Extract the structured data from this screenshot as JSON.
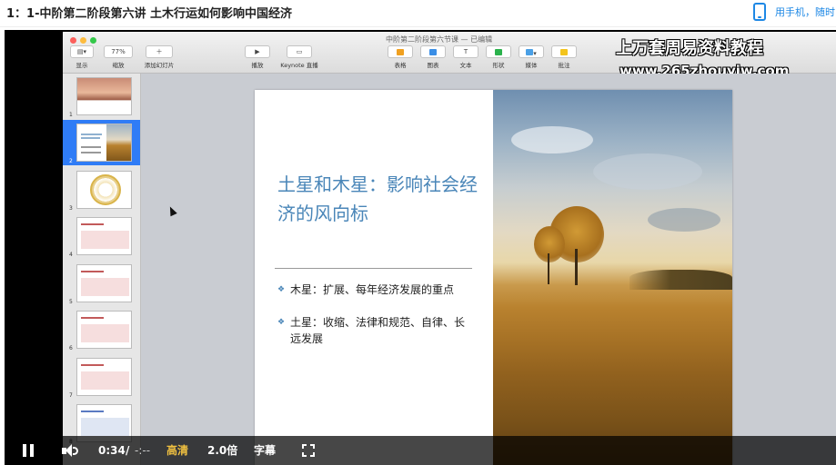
{
  "page": {
    "title": "1：1-中阶第二阶段第六讲 土木行运如何影响中国经济",
    "mobile_link": "用手机，随时"
  },
  "keynote": {
    "doc_title": "中阶第二阶段第六节课 — 已编辑",
    "toolbar": {
      "view": "显示",
      "zoom_value": "77%",
      "zoom": "缩放",
      "add_slide": "添加幻灯片",
      "play": "播放",
      "keynote_live": "Keynote 直播",
      "table": "表格",
      "chart": "图表",
      "text": "文本",
      "shape": "形状",
      "media": "媒体",
      "comment": "批注"
    },
    "watermark": {
      "line1": "上万套周易资料教程",
      "line2": "www.265zhouyiw.com"
    },
    "slides": [
      {
        "num": "1"
      },
      {
        "num": "2"
      },
      {
        "num": "3"
      },
      {
        "num": "4"
      },
      {
        "num": "5"
      },
      {
        "num": "6"
      },
      {
        "num": "7"
      },
      {
        "num": "8"
      }
    ],
    "selected_slide": 2,
    "current_slide": {
      "title": "土星和木星：影响社会经济的风向标",
      "bullet1": "木星：扩展、每年经济发展的重点",
      "bullet2": "土星：收缩、法律和规范、自律、长远发展"
    }
  },
  "player": {
    "current_time": "0:34",
    "separator": "/",
    "duration": "-:--",
    "quality": "高清",
    "speed": "2.0倍",
    "subtitles": "字幕"
  },
  "colors": {
    "accent_blue": "#1e88e5",
    "slide_title": "#4a86b8",
    "quality_gold": "#f0c040",
    "selection": "#2f7cf6"
  }
}
